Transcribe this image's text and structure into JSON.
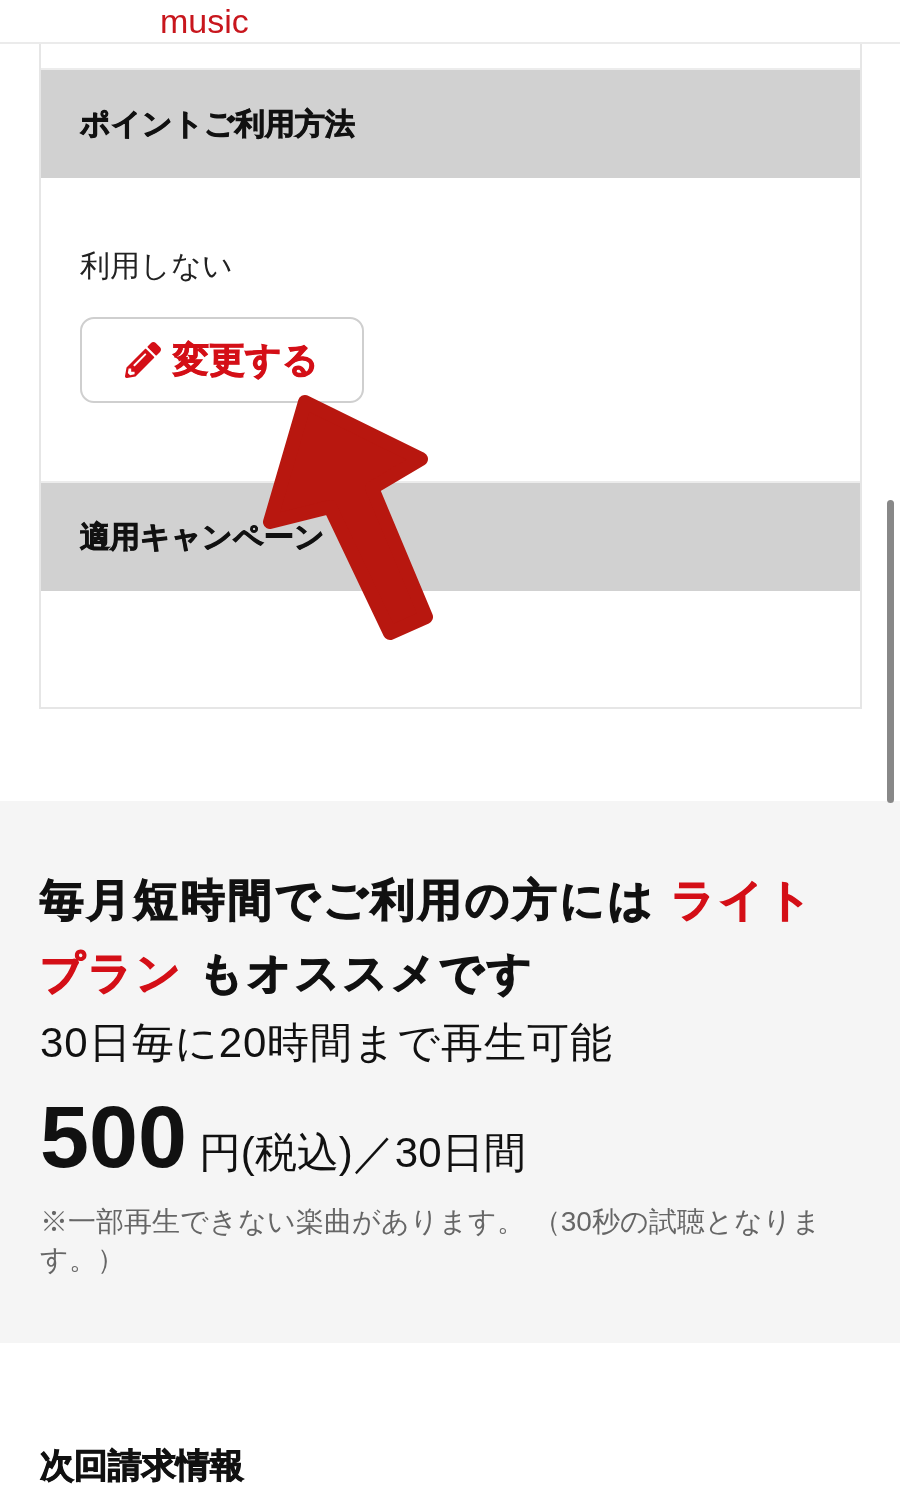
{
  "header": {
    "logo_text": "music"
  },
  "points_card": {
    "sections": [
      {
        "title": "ポイントご利用方法",
        "value": "利用しない",
        "button": {
          "label": "変更する"
        }
      },
      {
        "title": "適用キャンペーン"
      }
    ]
  },
  "promo": {
    "headline": [
      {
        "text": "毎月短時間でご利用の方には",
        "emphasis": false
      },
      {
        "text": "ライトプラン",
        "emphasis": true
      },
      {
        "text": "もオススメです",
        "emphasis": false
      }
    ],
    "subline": "30日毎に20時間まで再生可能",
    "price": "500",
    "price_unit": "円(税込)／30日間",
    "note": "※一部再生できない楽曲があります。 （30秒の試聴となります。）"
  },
  "next_billing": {
    "title": "次回請求情報"
  }
}
